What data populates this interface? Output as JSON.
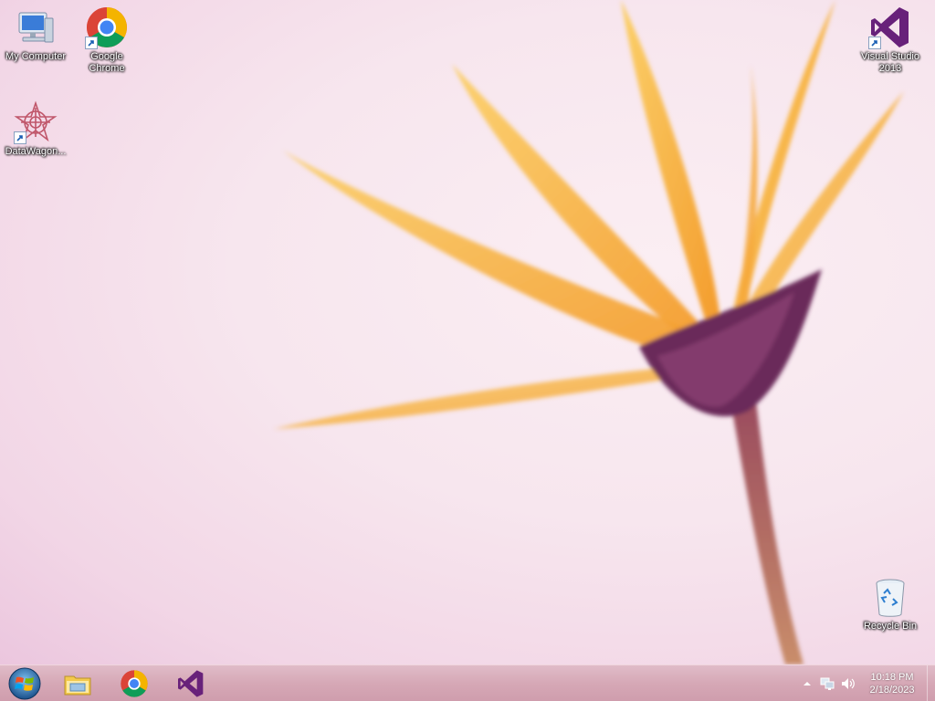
{
  "desktop": {
    "icons": [
      {
        "label": "My Computer",
        "icon": "computer-icon",
        "shortcut": false
      },
      {
        "label": "Google Chrome",
        "icon": "chrome-icon",
        "shortcut": true
      },
      {
        "label": "DataWagon...",
        "icon": "datawagon-icon",
        "shortcut": true
      },
      {
        "label": "Visual Studio 2013",
        "icon": "visual-studio-icon",
        "shortcut": true
      },
      {
        "label": "Recycle Bin",
        "icon": "recycle-bin-icon",
        "shortcut": false
      }
    ]
  },
  "taskbar": {
    "start": {
      "icon": "windows-start-icon"
    },
    "pinned": [
      {
        "icon": "file-explorer-icon"
      },
      {
        "icon": "chrome-icon"
      },
      {
        "icon": "visual-studio-icon"
      }
    ],
    "tray": {
      "icons": [
        "show-hidden-icons-arrow",
        "network-icon",
        "volume-icon"
      ],
      "time": "10:18 PM",
      "date": "2/18/2023"
    }
  },
  "colors": {
    "wallpaper_bg": "#f7e6ee",
    "petal": "#f7b33c",
    "flower_center": "#6a2a5a",
    "taskbar": "#d6a8b6",
    "vs_purple": "#68217a"
  }
}
